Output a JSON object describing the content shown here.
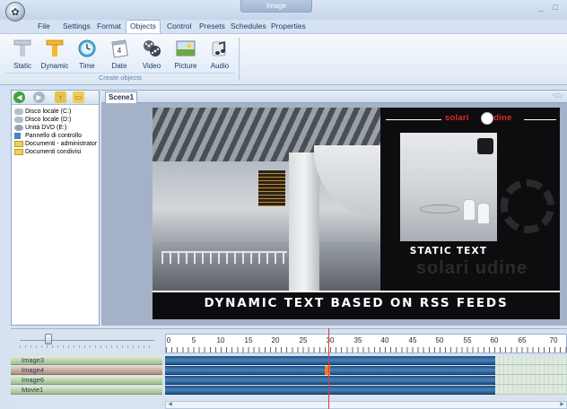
{
  "window": {
    "title": "Image",
    "min_glyph": "_",
    "max_glyph": "□"
  },
  "menu": {
    "items": [
      "File",
      "Settings",
      "Format",
      "Objects",
      "Control",
      "Presets",
      "Schedules",
      "Properties"
    ],
    "active": "Objects"
  },
  "ribbon": {
    "group_label": "Create objects",
    "tools": [
      {
        "label": "Static",
        "icon": "static-text-icon"
      },
      {
        "label": "Dynamic",
        "icon": "dynamic-text-icon"
      },
      {
        "label": "Time",
        "icon": "clock-icon"
      },
      {
        "label": "Date",
        "icon": "calendar-icon"
      },
      {
        "label": "Video",
        "icon": "film-reel-icon"
      },
      {
        "label": "Picture",
        "icon": "picture-icon"
      },
      {
        "label": "Audio",
        "icon": "music-note-icon"
      }
    ]
  },
  "explorer": {
    "items": [
      {
        "label": "Disco locale (C:)",
        "icon": "drive-icon"
      },
      {
        "label": "Disco locale (D:)",
        "icon": "drive-icon"
      },
      {
        "label": "Unità DVD (E:)",
        "icon": "dvd-drive-icon"
      },
      {
        "label": "Pannello di controllo",
        "icon": "control-panel-icon"
      },
      {
        "label": "Documenti - administrator",
        "icon": "folder-icon"
      },
      {
        "label": "Documenti condivisi",
        "icon": "folder-icon"
      }
    ]
  },
  "editor": {
    "tab": "Scene1",
    "arrows": "◁ ▷"
  },
  "scene": {
    "brand": "solari",
    "brand2": "udine",
    "static_text": "STATIC TEXT",
    "dynamic_text": "DYNAMIC TEXT BASED ON RSS FEEDS",
    "watermark": "solari  udine"
  },
  "timeline": {
    "ruler_labels": [
      "0",
      "5",
      "10",
      "15",
      "20",
      "25",
      "30",
      "35",
      "40",
      "45",
      "50",
      "55",
      "60",
      "65",
      "70"
    ],
    "tracks": [
      "Image3",
      "Image4",
      "Image6",
      "Movie1"
    ]
  },
  "colors": {
    "brand_red": "#e02a2a",
    "track_blue": "#2f6aa3",
    "accent_orange": "#f07a2a"
  }
}
